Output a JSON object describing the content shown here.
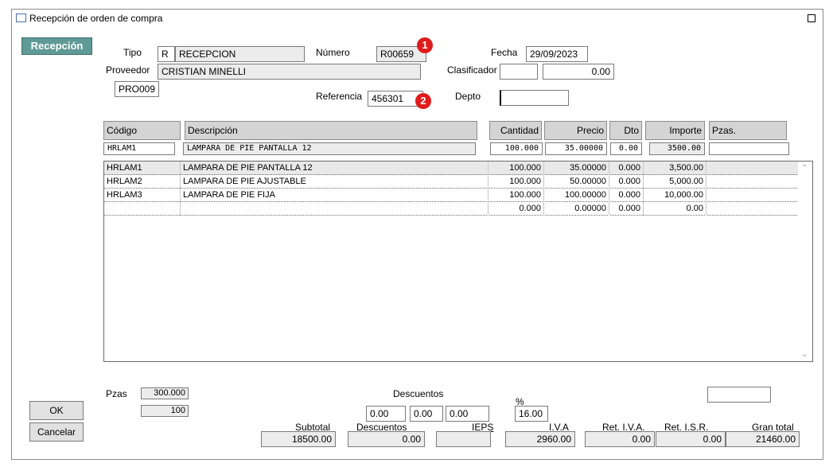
{
  "window": {
    "title": "Recepción de orden de compra"
  },
  "tab": {
    "label": "Recepción"
  },
  "header": {
    "tipo_label": "Tipo",
    "tipo_code": "R",
    "tipo_value": "RECEPCION",
    "numero_label": "Número",
    "numero_value": "R00659",
    "fecha_label": "Fecha",
    "fecha_value": "29/09/2023",
    "proveedor_label": "Proveedor",
    "proveedor_value": "CRISTIAN MINELLI",
    "proveedor_code": "PRO009",
    "clasificador_label": "Clasificador",
    "clasificador_code": "",
    "clasificador_value": "0.00",
    "referencia_label": "Referencia",
    "referencia_value": "456301",
    "depto_label": "Depto",
    "depto_value": ""
  },
  "badges": {
    "one": "1",
    "two": "2"
  },
  "columns": {
    "codigo": "Código",
    "descripcion": "Descripción",
    "cantidad": "Cantidad",
    "precio": "Precio",
    "dto": "Dto",
    "importe": "Importe",
    "pzas": "Pzas."
  },
  "entry": {
    "codigo": "HRLAM1",
    "descripcion": "LAMPARA DE PIE PANTALLA 12",
    "cantidad": "100.000",
    "precio": "35.00000",
    "dto": "0.00",
    "importe": "3500.00",
    "pzas": ""
  },
  "rows": [
    {
      "codigo": "HRLAM1",
      "descripcion": "LAMPARA DE PIE PANTALLA 12",
      "cantidad": "100.000",
      "precio": "35.00000",
      "dto": "0.000",
      "importe": "3,500.00",
      "pzas": ""
    },
    {
      "codigo": "HRLAM2",
      "descripcion": "LAMPARA DE PIE AJUSTABLE",
      "cantidad": "100.000",
      "precio": "50.00000",
      "dto": "0.000",
      "importe": "5,000.00",
      "pzas": ""
    },
    {
      "codigo": "HRLAM3",
      "descripcion": "LAMPARA DE PIE FIJA",
      "cantidad": "100.000",
      "precio": "100.00000",
      "dto": "0.000",
      "importe": "10,000.00",
      "pzas": ""
    },
    {
      "codigo": "",
      "descripcion": "",
      "cantidad": "0.000",
      "precio": "0.00000",
      "dto": "0.000",
      "importe": "0.00",
      "pzas": ""
    }
  ],
  "footer": {
    "pzas_label": "Pzas",
    "pzas_value": "300.000",
    "pzas_value2": "100",
    "descuentos_label": "Descuentos",
    "desc1": "0.00",
    "desc2": "0.00",
    "desc3": "0.00",
    "pct_label": "%",
    "pct_value": "16.00",
    "extra_field": "",
    "subtotal_label": "Subtotal",
    "subtotal_value": "18500.00",
    "descuentos_total_label": "Descuentos",
    "descuentos_total_value": "0.00",
    "ieps_label": "IEPS",
    "ieps_value": "",
    "iva_label": "I.V.A",
    "iva_value": "2960.00",
    "ret_iva_label": "Ret. I.V.A.",
    "ret_iva_value": "0.00",
    "ret_isr_label": "Ret. I.S.R.",
    "ret_isr_value": "0.00",
    "gran_total_label": "Gran total",
    "gran_total_value": "21460.00"
  },
  "buttons": {
    "ok": "OK",
    "cancel": "Cancelar"
  }
}
